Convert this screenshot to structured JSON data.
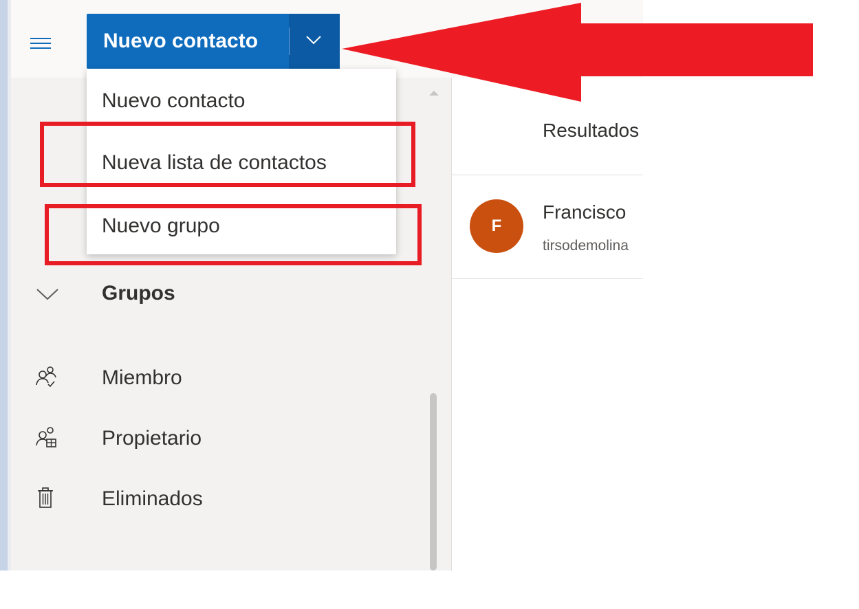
{
  "toolbar": {
    "menu_icon": "hamburger-icon",
    "new_contact_label": "Nuevo contacto",
    "dropdown_icon": "chevron-down-icon"
  },
  "dropdown_menu": {
    "items": [
      {
        "label": "Nuevo contacto"
      },
      {
        "label": "Nueva lista de contactos"
      },
      {
        "label": "Nuevo grupo"
      }
    ]
  },
  "sidebar": {
    "groups_header": {
      "label": "Grupos",
      "icon": "chevron-down-icon"
    },
    "items": [
      {
        "label": "Miembro",
        "icon": "people-check-icon"
      },
      {
        "label": "Propietario",
        "icon": "people-owner-icon"
      },
      {
        "label": "Eliminados",
        "icon": "trash-icon"
      }
    ]
  },
  "main": {
    "results_title": "Resultados",
    "contacts": [
      {
        "initial": "F",
        "name": "Francisco",
        "email": "tirsodemolina",
        "avatar_color": "#ca5010"
      }
    ]
  },
  "annotations": {
    "highlight_color": "#e81c24"
  },
  "colors": {
    "primary": "#0f6cbd",
    "primary_dark": "#0b5aa3",
    "sidebar_bg": "#f3f2f1"
  }
}
